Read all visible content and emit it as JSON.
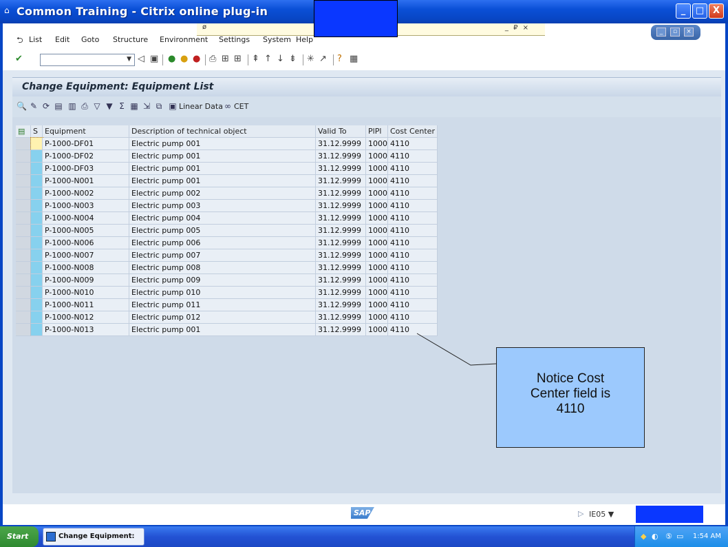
{
  "window": {
    "title": "Common Training - Citrix online plug-in",
    "minimize": "_",
    "maximize": "□",
    "close": "X"
  },
  "menu": {
    "items": [
      "List",
      "Edit",
      "Goto",
      "Structure",
      "Environment",
      "Settings",
      "System",
      "Help"
    ],
    "inner_controls": "_ ₽ ×"
  },
  "page_title": "Change Equipment: Equipment List",
  "app_toolbar": {
    "linear_data_label": "Linear Data",
    "cet_label": "CET"
  },
  "table": {
    "headers": [
      "",
      "S",
      "Equipment",
      "Description of technical object",
      "Valid To",
      "PlPl",
      "Cost Center"
    ],
    "rows": [
      [
        "P-1000-DF01",
        "Electric pump 001",
        "31.12.9999",
        "1000",
        "4110"
      ],
      [
        "P-1000-DF02",
        "Electric pump 001",
        "31.12.9999",
        "1000",
        "4110"
      ],
      [
        "P-1000-DF03",
        "Electric pump 001",
        "31.12.9999",
        "1000",
        "4110"
      ],
      [
        "P-1000-N001",
        "Electric pump 001",
        "31.12.9999",
        "1000",
        "4110"
      ],
      [
        "P-1000-N002",
        "Electric pump 002",
        "31.12.9999",
        "1000",
        "4110"
      ],
      [
        "P-1000-N003",
        "Electric pump 003",
        "31.12.9999",
        "1000",
        "4110"
      ],
      [
        "P-1000-N004",
        "Electric pump 004",
        "31.12.9999",
        "1000",
        "4110"
      ],
      [
        "P-1000-N005",
        "Electric pump 005",
        "31.12.9999",
        "1000",
        "4110"
      ],
      [
        "P-1000-N006",
        "Electric pump 006",
        "31.12.9999",
        "1000",
        "4110"
      ],
      [
        "P-1000-N007",
        "Electric pump 007",
        "31.12.9999",
        "1000",
        "4110"
      ],
      [
        "P-1000-N008",
        "Electric pump 008",
        "31.12.9999",
        "1000",
        "4110"
      ],
      [
        "P-1000-N009",
        "Electric pump 009",
        "31.12.9999",
        "1000",
        "4110"
      ],
      [
        "P-1000-N010",
        "Electric pump 010",
        "31.12.9999",
        "1000",
        "4110"
      ],
      [
        "P-1000-N011",
        "Electric pump 011",
        "31.12.9999",
        "1000",
        "4110"
      ],
      [
        "P-1000-N012",
        "Electric pump 012",
        "31.12.9999",
        "1000",
        "4110"
      ],
      [
        "P-1000-N013",
        "Electric pump 001",
        "31.12.9999",
        "1000",
        "4110"
      ]
    ]
  },
  "callout": {
    "lines": [
      "Notice Cost",
      "Center field is",
      "4110"
    ]
  },
  "statusbar": {
    "logo": "SAP",
    "system": "IE05"
  },
  "taskbar": {
    "start": "Start",
    "task": "Change Equipment: E...",
    "clock": "1:54 AM"
  },
  "colors": {
    "title_blue": "#0846c5",
    "callout_fill": "#9cc9fd",
    "redaction_blue": "#0a37ff",
    "status_cell": "#87d1ee"
  }
}
